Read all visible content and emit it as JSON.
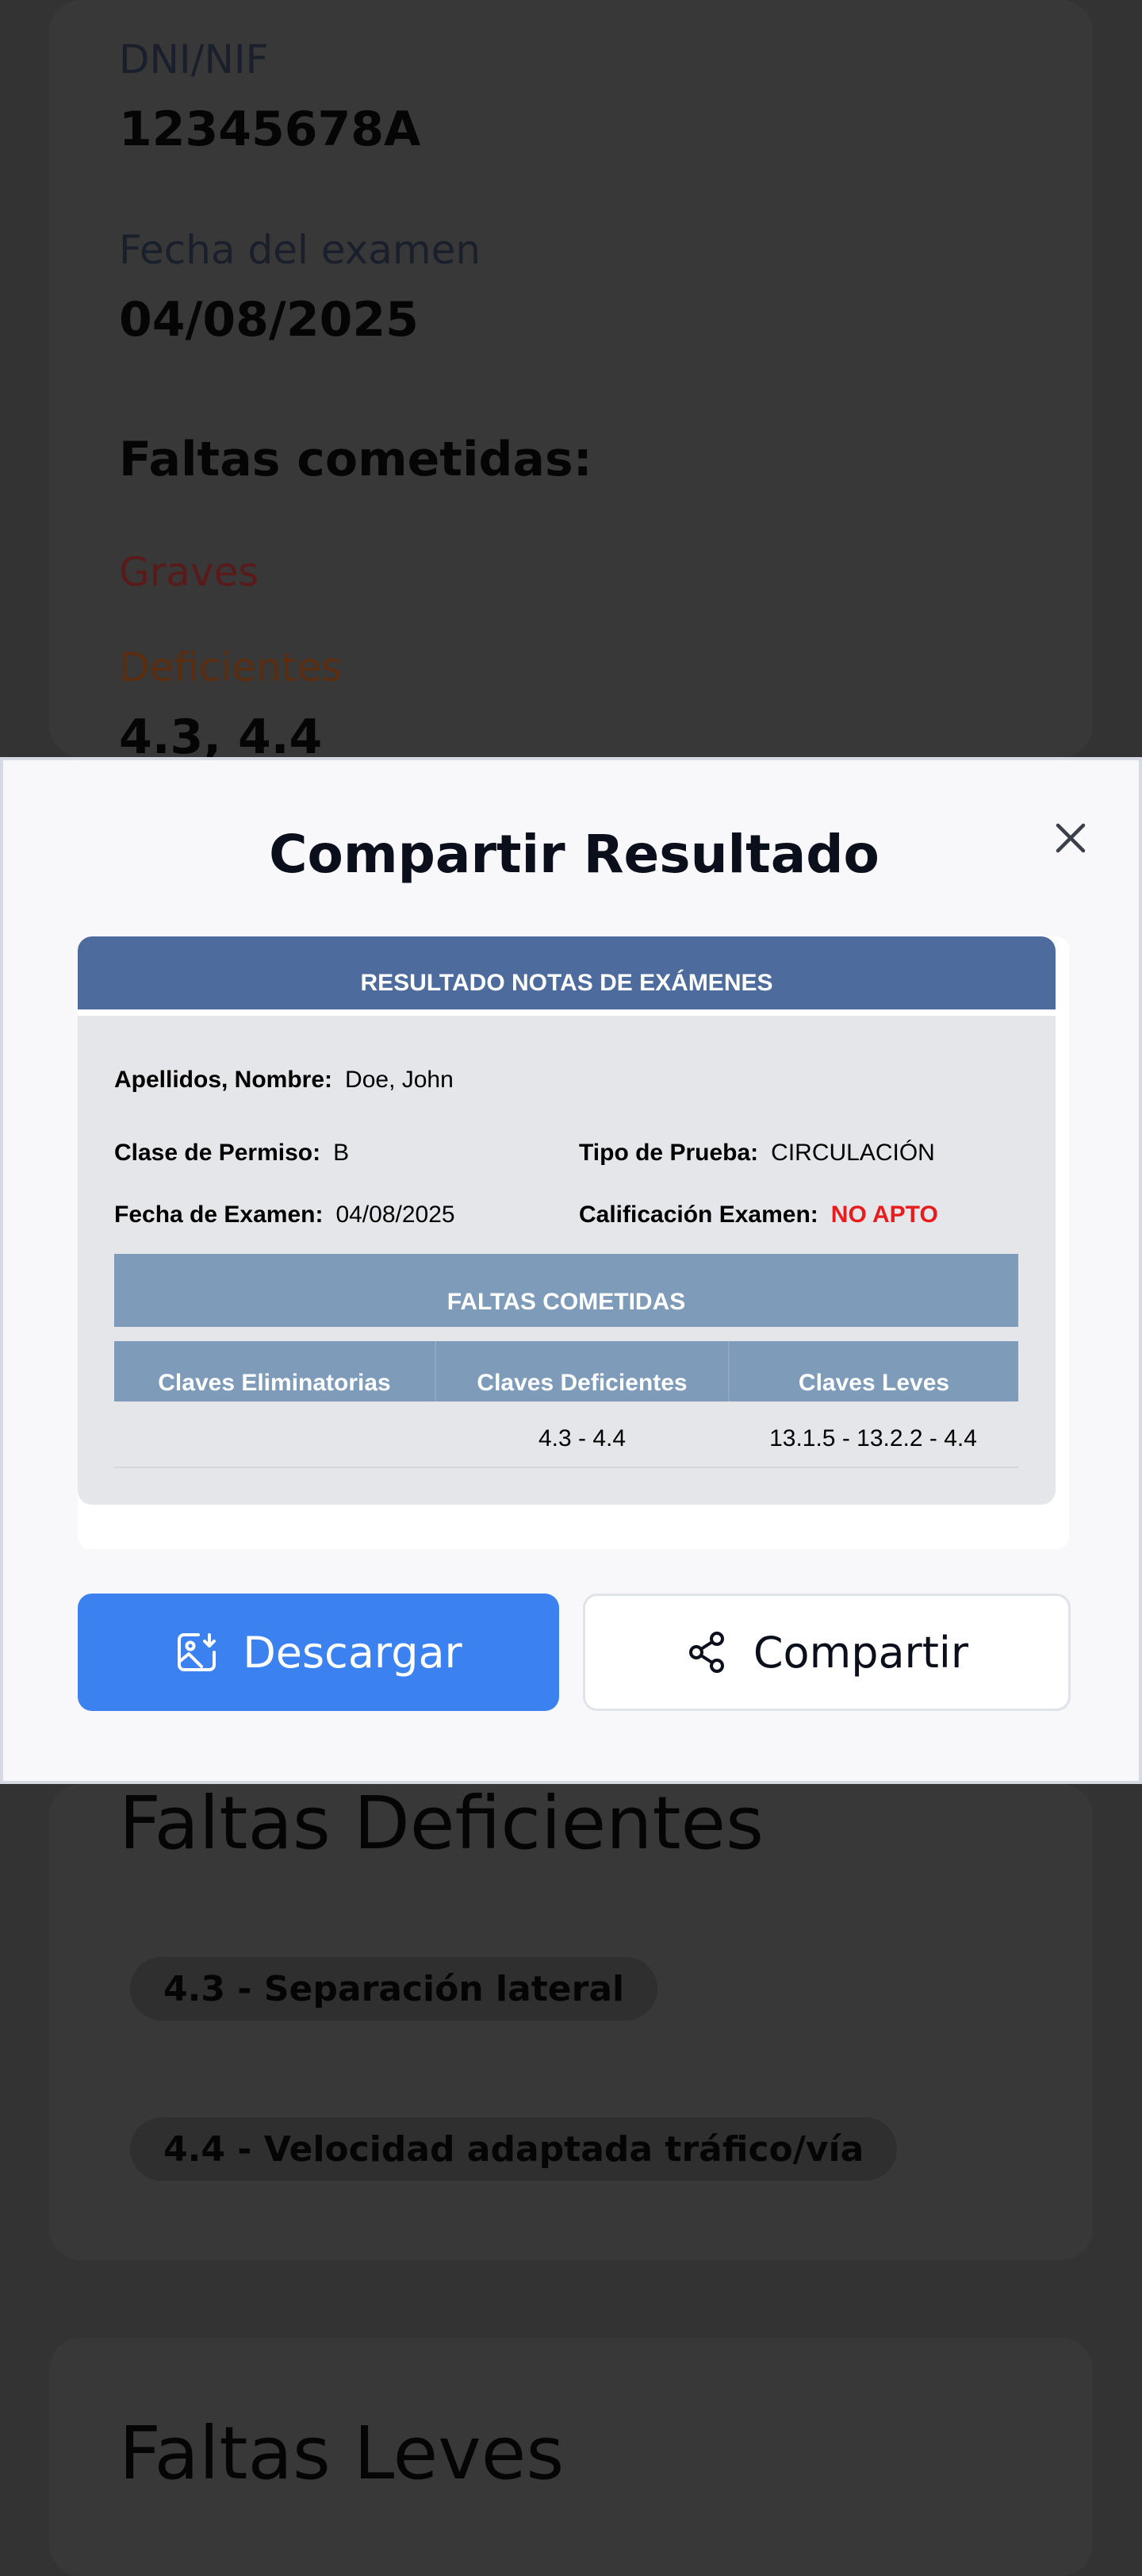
{
  "background": {
    "dni_label": "DNI/NIF",
    "dni_value": "12345678A",
    "fecha_label": "Fecha del examen",
    "fecha_value": "04/08/2025",
    "faltas_heading": "Faltas cometidas:",
    "graves_label": "Graves",
    "deficientes_label": "Deficientes",
    "deficientes_value": "4.3, 4.4",
    "faltas_deficientes_title": "Faltas Deficientes",
    "deficientes_items": [
      "4.3 - Separación lateral",
      "4.4 - Velocidad adaptada tráfico/vía"
    ],
    "faltas_leves_title": "Faltas Leves"
  },
  "modal": {
    "title": "Compartir Resultado",
    "result_card": {
      "header": "RESULTADO NOTAS DE EXÁMENES",
      "apellidos_label": "Apellidos, Nombre:",
      "apellidos_value": "Doe, John",
      "clase_label": "Clase de Permiso:",
      "clase_value": "B",
      "tipo_label": "Tipo de Prueba:",
      "tipo_value": "CIRCULACIÓN",
      "fecha_label": "Fecha de Examen:",
      "fecha_value": "04/08/2025",
      "calificacion_label": "Calificación Examen:",
      "calificacion_value": "NO APTO",
      "faltas_header": "FALTAS COMETIDAS",
      "columns": [
        "Claves Eliminatorias",
        "Claves Deficientes",
        "Claves Leves"
      ],
      "row": [
        "",
        "4.3 - 4.4",
        "13.1.5 - 13.2.2 - 4.4"
      ]
    },
    "download_label": "Descargar",
    "share_label": "Compartir"
  },
  "colors": {
    "overlay": "#333333",
    "header_blue": "#4d6b9c",
    "table_blue": "#7e9bba",
    "primary_button": "#3b82f0",
    "fail_red": "#e81c1c"
  },
  "icons": {
    "close": "close-icon",
    "download": "image-download-icon",
    "share": "share-icon"
  }
}
